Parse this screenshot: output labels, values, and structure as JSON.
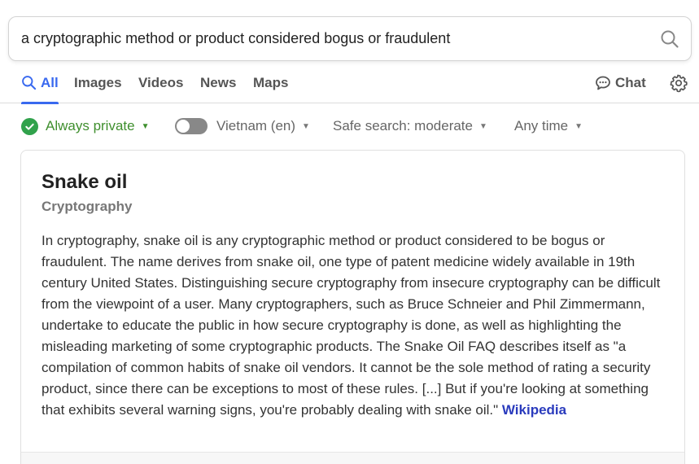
{
  "search": {
    "query": "a cryptographic method or product considered bogus or fraudulent"
  },
  "nav": {
    "tabs": [
      {
        "label": "All",
        "active": true
      },
      {
        "label": "Images"
      },
      {
        "label": "Videos"
      },
      {
        "label": "News"
      },
      {
        "label": "Maps"
      }
    ],
    "chat_label": "Chat"
  },
  "filters": {
    "privacy": "Always private",
    "region": "Vietnam (en)",
    "safe_search": "Safe search: moderate",
    "time": "Any time"
  },
  "card": {
    "title": "Snake oil",
    "subtitle": "Cryptography",
    "body": "In cryptography, snake oil is any cryptographic method or product considered to be bogus or fraudulent. The name derives from snake oil, one type of patent medicine widely available in 19th century United States. Distinguishing secure cryptography from insecure cryptography can be difficult from the viewpoint of a user. Many cryptographers, such as Bruce Schneier and Phil Zimmermann, undertake to educate the public in how secure cryptography is done, as well as highlighting the misleading marketing of some cryptographic products. The Snake Oil FAQ describes itself as \"a compilation of common habits of snake oil vendors. It cannot be the sole method of rating a security product, since there can be exceptions to most of these rules. [...] But if you're looking at something that exhibits several warning signs, you're probably dealing with snake oil.\"",
    "source_link": "Wikipedia"
  },
  "colors": {
    "accent": "#3969ef",
    "private_green": "#3f8f2e",
    "link": "#2a3bbd"
  },
  "icons": {
    "search": "search-icon",
    "chat": "chat-bubble-icon",
    "settings": "gear-icon",
    "check": "check-circle-icon"
  }
}
